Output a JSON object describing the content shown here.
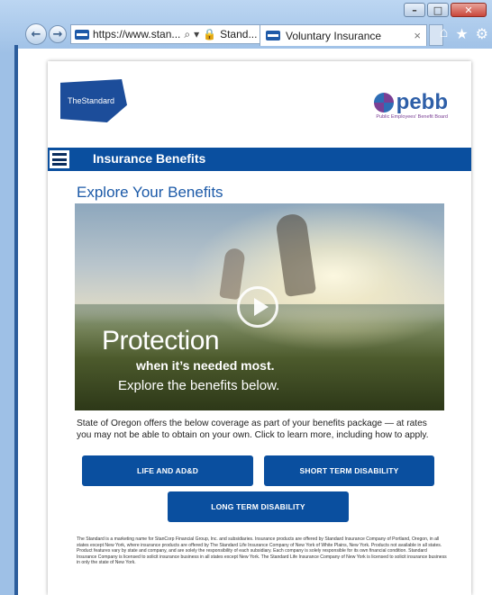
{
  "browser": {
    "address_url": "https://www.stan...",
    "address_site": "Stand...",
    "tab_title": "Voluntary Insurance",
    "tab_close": "×"
  },
  "header": {
    "logo_left_text": "TheStandard",
    "logo_right_word": "pebb",
    "logo_right_sub": "Public Employees' Benefit Board"
  },
  "banner": {
    "title": "Insurance Benefits"
  },
  "main": {
    "title": "Explore Your Benefits",
    "hero": {
      "line1": "Protection",
      "line2": "when it’s needed most.",
      "line3": "Explore the benefits below."
    },
    "intro": "State of Oregon offers the below coverage as part of your benefits package — at rates you may not be able to obtain on your own. Click to learn more, including how to apply.",
    "buttons": {
      "life": "LIFE AND AD&D",
      "short": "SHORT TERM DISABILITY",
      "long": "LONG TERM DISABILITY"
    },
    "disclaimer": "The Standard is a marketing name for StanCorp Financial Group, Inc. and subsidiaries. Insurance products are offered by Standard Insurance Company of Portland, Oregon, in all states except New York, where insurance products are offered by The Standard Life Insurance Company of New York of White Plains, New York. Products not available in all states. Product features vary by state and company, and are solely the responsibility of each subsidiary. Each company is solely responsible for its own financial condition. Standard Insurance Company is licensed to solicit insurance business in all states except New York. The Standard Life Insurance Company of New York is licensed to solicit insurance business in only the state of New York."
  },
  "colors": {
    "brand_blue": "#0a4f9f",
    "title_blue": "#1c5aa8",
    "pebb_purple": "#7a3f94"
  }
}
